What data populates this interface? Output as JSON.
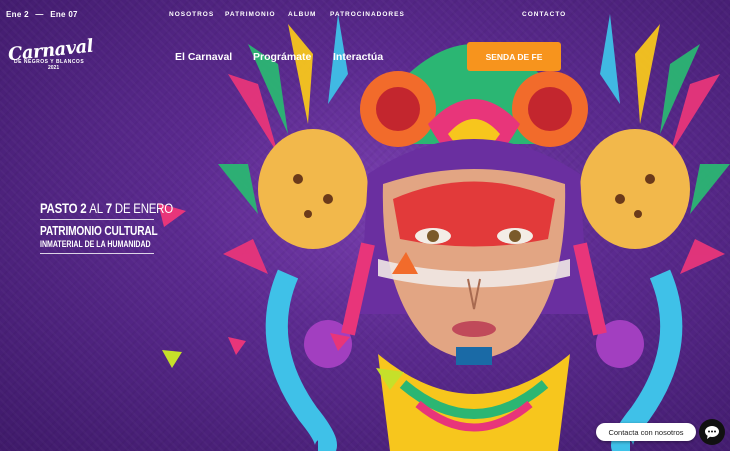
{
  "topbar": {
    "date_start": "Ene 2",
    "date_separator": "—",
    "date_end": "Ene 07",
    "nav": [
      {
        "label": "NOSOTROS"
      },
      {
        "label": "PATRIMONIO"
      },
      {
        "label": "ALBUM"
      },
      {
        "label": "PATROCINADORES"
      },
      {
        "label": "CONTACTO"
      }
    ]
  },
  "logo": {
    "line1": "Carnaval",
    "line2": "DE NEGROS Y BLANCOS",
    "line3": "2021"
  },
  "mainnav": [
    {
      "label": "El Carnaval"
    },
    {
      "label": "Prográmate"
    },
    {
      "label": "Interactúa"
    }
  ],
  "cta": {
    "label": "SENDA DE FE",
    "color": "#f7941d"
  },
  "hero": {
    "city": "PASTO",
    "day_start": "2",
    "al": "AL",
    "day_end": "7",
    "month": "DE ENERO",
    "line2": "PATRIMONIO CULTURAL",
    "line3": "INMATERIAL DE LA HUMANIDAD"
  },
  "chat": {
    "label": "Contacta con nosotros",
    "icon": "chat-bubble-icon"
  },
  "colors": {
    "background": "#5b2a8f",
    "accent": "#f7941d"
  }
}
